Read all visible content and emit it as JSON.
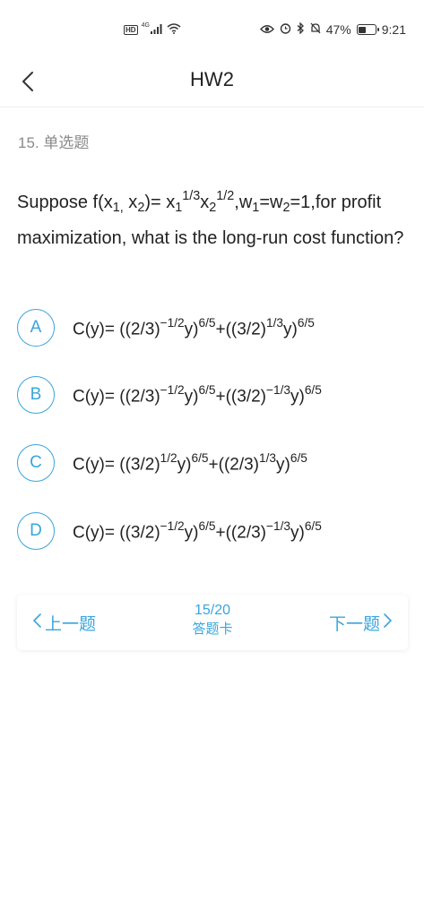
{
  "status_bar": {
    "hd": "HD",
    "network": "4G",
    "battery_percent": "47%",
    "battery_level": 0.47,
    "time": "9:21"
  },
  "nav": {
    "title": "HW2"
  },
  "question": {
    "type_label": "15. 单选题",
    "text_html": "Suppose f(x<sub>1,</sub> x<sub>2</sub>)= x<sub>1</sub><sup>1/3</sup>x<sub>2</sub><sup>1/2</sup>,w<sub>1</sub>=w<sub>2</sub>=1,for profit maximization, what is the long-run cost function?"
  },
  "options": [
    {
      "letter": "A",
      "text_html": "C(y)= ((2/3)<sup>−1/2</sup>y)<sup>6/5</sup>+((3/2)<sup>1/3</sup>y)<sup>6/5</sup>"
    },
    {
      "letter": "B",
      "text_html": "C(y)= ((2/3)<sup>−1/2</sup>y)<sup>6/5</sup>+((3/2)<sup>−1/3</sup>y)<sup>6/5</sup>"
    },
    {
      "letter": "C",
      "text_html": "C(y)= ((3/2)<sup>1/2</sup>y)<sup>6/5</sup>+((2/3)<sup>1/3</sup>y)<sup>6/5</sup>"
    },
    {
      "letter": "D",
      "text_html": "C(y)= ((3/2)<sup>−1/2</sup>y)<sup>6/5</sup>+((2/3)<sup>−1/3</sup>y)<sup>6/5</sup>"
    }
  ],
  "footer": {
    "prev_label": "上一题",
    "next_label": "下一题",
    "progress": "15/20",
    "answer_card_label": "答题卡"
  },
  "colors": {
    "accent": "#39a5dc",
    "muted_text": "#8a8a8a",
    "body_text": "#222222"
  }
}
